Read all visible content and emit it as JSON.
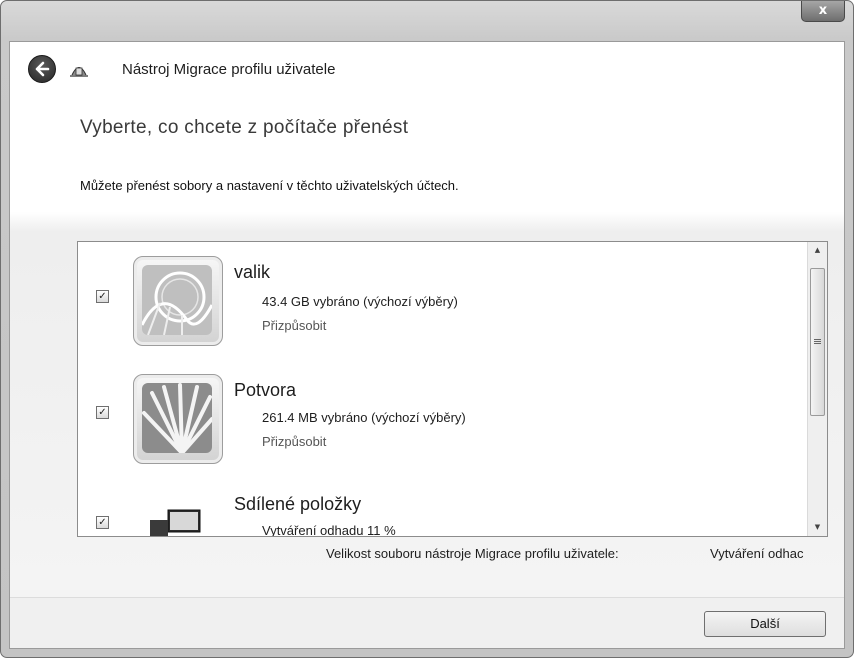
{
  "window": {
    "title": "Nástroj Migrace profilu uživatele",
    "close_label": "x"
  },
  "page": {
    "heading": "Vyberte, co chcete z počítače přenést",
    "description": "Můžete přenést sobory a nastavení v těchto uživatelských účtech."
  },
  "accounts": [
    {
      "name": "valik",
      "size": "43.4 GB vybráno (výchozí výběry)",
      "customize": "Přizpůsobit",
      "checked": true,
      "icon": "rollercoaster-image-icon"
    },
    {
      "name": "Potvora",
      "size": "261.4 MB vybráno (výchozí výběry)",
      "customize": "Přizpůsobit",
      "checked": true,
      "icon": "flower-image-icon"
    },
    {
      "name": "Sdílené položky",
      "size": "Vytváření odhadu 11 %",
      "checked": true,
      "icon": "computer-icon"
    }
  ],
  "footer": {
    "size_label": "Velikost souboru nástroje Migrace profilu uživatele:",
    "size_value": "Vytváření odhac"
  },
  "buttons": {
    "next": "Další"
  }
}
